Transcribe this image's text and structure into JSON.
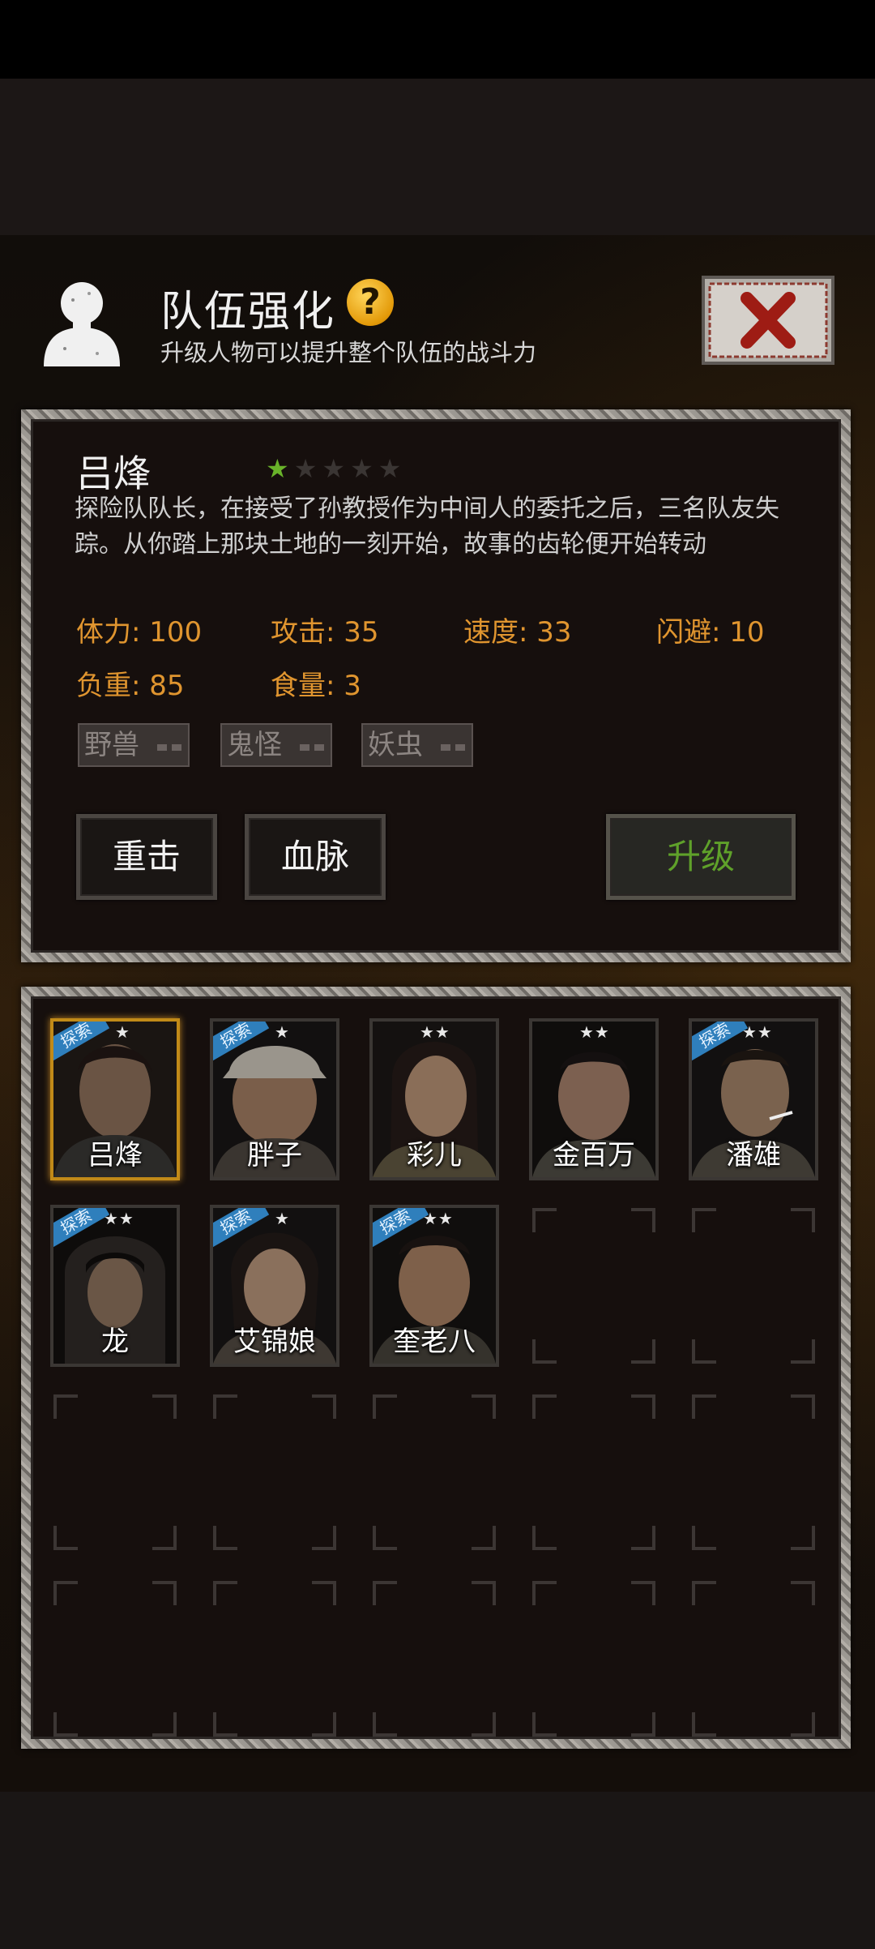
{
  "header": {
    "title": "队伍强化",
    "help_icon": "?",
    "subtitle": "升级人物可以提升整个队伍的战斗力"
  },
  "character": {
    "name": "吕烽",
    "stars": 1,
    "max_stars": 5,
    "description": "探险队队长，在接受了孙教授作为中间人的委托之后，三名队友失踪。从你踏上那块土地的一刻开始，故事的齿轮便开始转动",
    "stats": [
      {
        "label": "体力: 100"
      },
      {
        "label": "攻击: 35"
      },
      {
        "label": "速度: 33"
      },
      {
        "label": "闪避: 10"
      },
      {
        "label": "负重: 85"
      },
      {
        "label": "食量: 3"
      }
    ],
    "tags": [
      "野兽",
      "鬼怪",
      "妖虫"
    ],
    "skills": [
      "重击",
      "血脉"
    ],
    "upgrade_label": "升级"
  },
  "roster": [
    {
      "name": "吕烽",
      "badge": "探索",
      "stars": "★",
      "selected": true
    },
    {
      "name": "胖子",
      "badge": "探索",
      "stars": "★"
    },
    {
      "name": "彩儿",
      "badge": "",
      "stars": "★★"
    },
    {
      "name": "金百万",
      "badge": "",
      "stars": "★★"
    },
    {
      "name": "潘雄",
      "badge": "探索",
      "stars": "★★"
    },
    {
      "name": "龙",
      "badge": "探索",
      "stars": "★★"
    },
    {
      "name": "艾锦娘",
      "badge": "探索",
      "stars": "★"
    },
    {
      "name": "奎老八",
      "badge": "探索",
      "stars": "★★"
    }
  ],
  "colors": {
    "accent_orange": "#e0952f",
    "upgrade_green": "#5fa12a",
    "star_green": "#69b32a",
    "badge_blue": "#2f7fbc",
    "selected_gold": "#c18a18"
  }
}
